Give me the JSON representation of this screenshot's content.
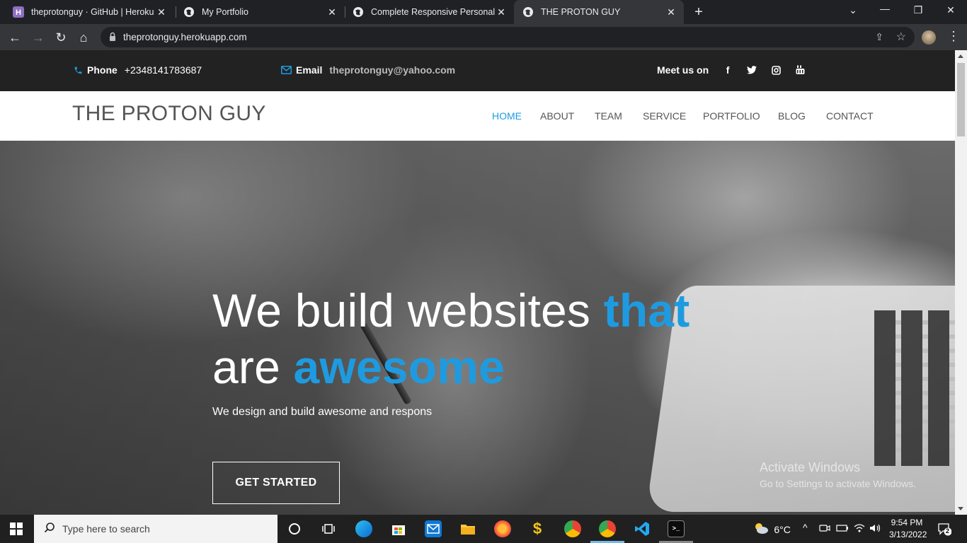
{
  "browser": {
    "tabs": [
      {
        "title": "theprotonguy · GitHub | Heroku",
        "active": false
      },
      {
        "title": "My Portfolio",
        "active": false
      },
      {
        "title": "Complete Responsive Personal Po",
        "active": false
      },
      {
        "title": "THE PROTON GUY",
        "active": true
      }
    ],
    "url": "theprotonguy.herokuapp.com"
  },
  "infobar": {
    "phone_label": "Phone",
    "phone_value": "+2348141783687",
    "email_label": "Email",
    "email_value": "theprotonguy@yahoo.com",
    "social_label": "Meet us on",
    "social_icons": [
      "facebook-icon",
      "twitter-icon",
      "instagram-icon",
      "youtube-icon"
    ]
  },
  "header": {
    "logo": "THE PROTON GUY",
    "nav": [
      {
        "label": "HOME",
        "active": true
      },
      {
        "label": "ABOUT",
        "active": false
      },
      {
        "label": "TEAM",
        "active": false
      },
      {
        "label": "SERVICE",
        "active": false
      },
      {
        "label": "PORTFOLIO",
        "active": false
      },
      {
        "label": "BLOG",
        "active": false
      },
      {
        "label": "CONTACT",
        "active": false
      }
    ]
  },
  "hero": {
    "headline_part1": "We build websites ",
    "headline_highlight1": "that",
    "headline_part2": "are ",
    "headline_highlight2": "awesome",
    "subline": "We design and build awesome and respons",
    "cta_label": "GET STARTED"
  },
  "watermark": {
    "line1": "Activate Windows",
    "line2": "Go to Settings to activate Windows."
  },
  "taskbar": {
    "search_placeholder": "Type here to search",
    "weather": "6°C",
    "time": "9:54 PM",
    "date": "3/13/2022",
    "notifications": "2"
  },
  "colors": {
    "accent": "#1e9be0",
    "infobar_bg": "#222222",
    "chrome_bg": "#202124"
  }
}
